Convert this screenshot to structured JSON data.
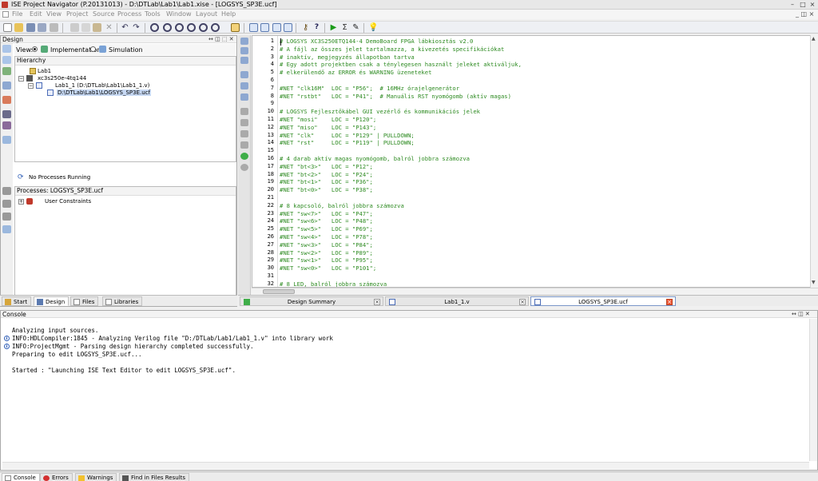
{
  "window": {
    "title": "ISE Project Navigator (P.20131013) - D:\\DTLab\\Lab1\\Lab1.xise - [LOGSYS_SP3E.ucf]",
    "controls": [
      "–",
      "□",
      "×"
    ]
  },
  "menu": [
    "File",
    "Edit",
    "View",
    "Project",
    "Source",
    "Process",
    "Tools",
    "Window",
    "Layout",
    "Help"
  ],
  "design_panel": {
    "title": "Design",
    "view_label": "View:",
    "view_options": [
      "Implementation",
      "Simulation"
    ],
    "hierarchy_title": "Hierarchy",
    "tree": [
      {
        "label": "Lab1",
        "icon": "project-icon"
      },
      {
        "label": "xc3s250e-4tq144",
        "icon": "device-icon"
      },
      {
        "label": "Lab1_1 (D:\\DTLab\\Lab1\\Lab1_1.v)",
        "icon": "verilog-module-icon"
      },
      {
        "label": "D:\\DTLab\\Lab1\\LOGSYS_SP3E.ucf",
        "icon": "ucf-file-icon"
      }
    ],
    "process_status": "No Processes Running",
    "processes_title": "Processes: LOGSYS_SP3E.ucf",
    "processes": [
      {
        "label": "User Constraints",
        "icon": "constraints-icon"
      }
    ]
  },
  "left_tabs": [
    "Start",
    "Design",
    "Files",
    "Libraries"
  ],
  "editor": {
    "lines": [
      {
        "n": "1",
        "t": "# LOGSYS XC3S250ETQ144-4 DemoBoard FPGA lábkiosztás v2.0"
      },
      {
        "n": "2",
        "t": "# A fájl az összes jelet tartalmazza, a kivezetés specifikációkat"
      },
      {
        "n": "3",
        "t": "# inaktív, megjegyzés állapotban tartva"
      },
      {
        "n": "4",
        "t": "# Egy adott projektben csak a ténylegesen használt jeleket aktiváljuk,"
      },
      {
        "n": "5",
        "t": "# elkerülendő az ERROR és WARNING üzeneteket"
      },
      {
        "n": "6",
        "t": ""
      },
      {
        "n": "7",
        "t": "#NET \"clk16M\"  LOC = \"P56\";  # 16MHz órajelgenerátor"
      },
      {
        "n": "8",
        "t": "#NET \"rstbt\"   LOC = \"P41\";  # Manuális RST nyomógomb (aktív magas)"
      },
      {
        "n": "9",
        "t": ""
      },
      {
        "n": "10",
        "t": "# LOGSYS Fejlesztőkábel GUI vezérlő és kommunikációs jelek"
      },
      {
        "n": "11",
        "t": "#NET \"mosi\"    LOC = \"P120\";"
      },
      {
        "n": "12",
        "t": "#NET \"miso\"    LOC = \"P143\";"
      },
      {
        "n": "13",
        "t": "#NET \"clk\"     LOC = \"P129\" | PULLDOWN;"
      },
      {
        "n": "14",
        "t": "#NET \"rst\"     LOC = \"P119\" | PULLDOWN;"
      },
      {
        "n": "15",
        "t": ""
      },
      {
        "n": "16",
        "t": "# 4 darab aktív magas nyomógomb, balról jobbra számozva"
      },
      {
        "n": "17",
        "t": "#NET \"bt<3>\"   LOC = \"P12\";"
      },
      {
        "n": "18",
        "t": "#NET \"bt<2>\"   LOC = \"P24\";"
      },
      {
        "n": "19",
        "t": "#NET \"bt<1>\"   LOC = \"P36\";"
      },
      {
        "n": "20",
        "t": "#NET \"bt<0>\"   LOC = \"P38\";"
      },
      {
        "n": "21",
        "t": ""
      },
      {
        "n": "22",
        "t": "# 8 kapcsoló, balról jobbra számozva"
      },
      {
        "n": "23",
        "t": "#NET \"sw<7>\"   LOC = \"P47\";"
      },
      {
        "n": "24",
        "t": "#NET \"sw<6>\"   LOC = \"P48\";"
      },
      {
        "n": "25",
        "t": "#NET \"sw<5>\"   LOC = \"P69\";"
      },
      {
        "n": "26",
        "t": "#NET \"sw<4>\"   LOC = \"P78\";"
      },
      {
        "n": "27",
        "t": "#NET \"sw<3>\"   LOC = \"P84\";"
      },
      {
        "n": "28",
        "t": "#NET \"sw<2>\"   LOC = \"P89\";"
      },
      {
        "n": "29",
        "t": "#NET \"sw<1>\"   LOC = \"P95\";"
      },
      {
        "n": "30",
        "t": "#NET \"sw<0>\"   LOC = \"P101\";"
      },
      {
        "n": "31",
        "t": ""
      },
      {
        "n": "32",
        "t": "# 8 LED, balról jobbra számozva"
      }
    ],
    "code_color": "#2e8b22"
  },
  "editor_tabs": [
    {
      "label": "Design Summary",
      "icon": "summary-icon"
    },
    {
      "label": "Lab1_1.v",
      "icon": "verilog-file-icon"
    },
    {
      "label": "LOGSYS_SP3E.ucf",
      "icon": "ucf-file-icon"
    }
  ],
  "console": {
    "title": "Console",
    "lines": [
      {
        "t": "Analyzing input sources.",
        "info": false
      },
      {
        "t": "INFO:HDLCompiler:1845 - Analyzing Verilog file \"D:/DTLab/Lab1/Lab1_1.v\" into library work",
        "info": true
      },
      {
        "t": "INFO:ProjectMgmt - Parsing design hierarchy completed successfully.",
        "info": true
      },
      {
        "t": "Preparing to edit LOGSYS_SP3E.ucf...",
        "info": false
      },
      {
        "t": "",
        "info": false
      },
      {
        "t": "Started : \"Launching ISE Text Editor to edit LOGSYS_SP3E.ucf\".",
        "info": false
      }
    ]
  },
  "bottom_tabs": [
    "Console",
    "Errors",
    "Warnings",
    "Find in Files Results"
  ]
}
